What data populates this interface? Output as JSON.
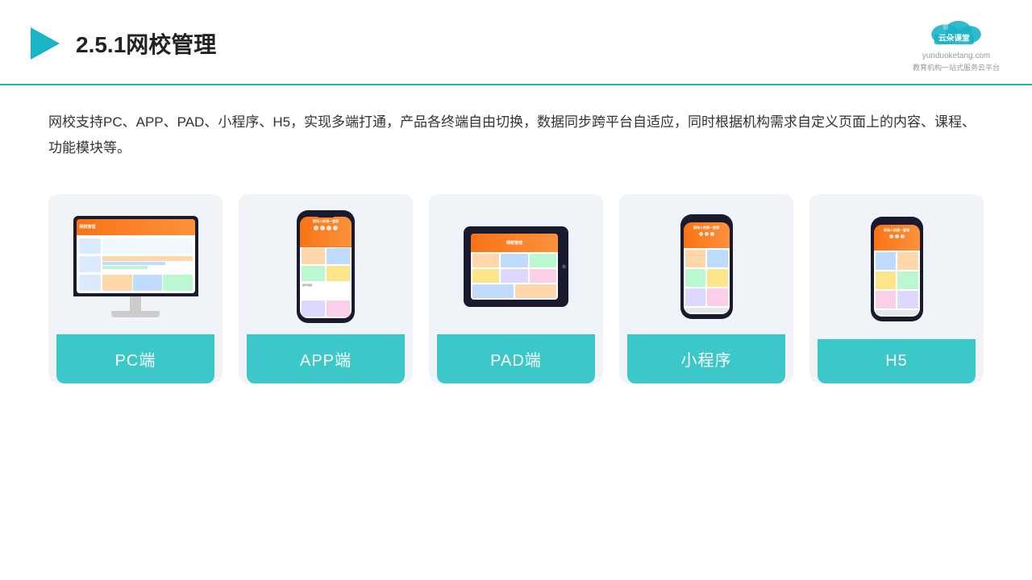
{
  "header": {
    "title": "2.5.1网校管理",
    "brand_name": "云朵课堂",
    "brand_url": "yunduoketang.com",
    "brand_slogan": "教育机构一站式服务云平台"
  },
  "description": {
    "text": "网校支持PC、APP、PAD、小程序、H5，实现多端打通，产品各终端自由切换，数据同步跨平台自适应，同时根据机构需求自定义页面上的内容、课程、功能模块等。"
  },
  "devices": [
    {
      "id": "pc",
      "label": "PC端",
      "type": "pc"
    },
    {
      "id": "app",
      "label": "APP端",
      "type": "phone"
    },
    {
      "id": "pad",
      "label": "PAD端",
      "type": "pad"
    },
    {
      "id": "miniprogram",
      "label": "小程序",
      "type": "phone"
    },
    {
      "id": "h5",
      "label": "H5",
      "type": "phone"
    }
  ],
  "colors": {
    "teal": "#3cc8c8",
    "orange": "#f97316",
    "dark": "#1a1a2e",
    "accent_blue": "#3b82f6",
    "accent_green": "#22c55e",
    "accent_yellow": "#fbbf24",
    "accent_purple": "#a855f7",
    "light_bg": "#f0f4f8"
  }
}
